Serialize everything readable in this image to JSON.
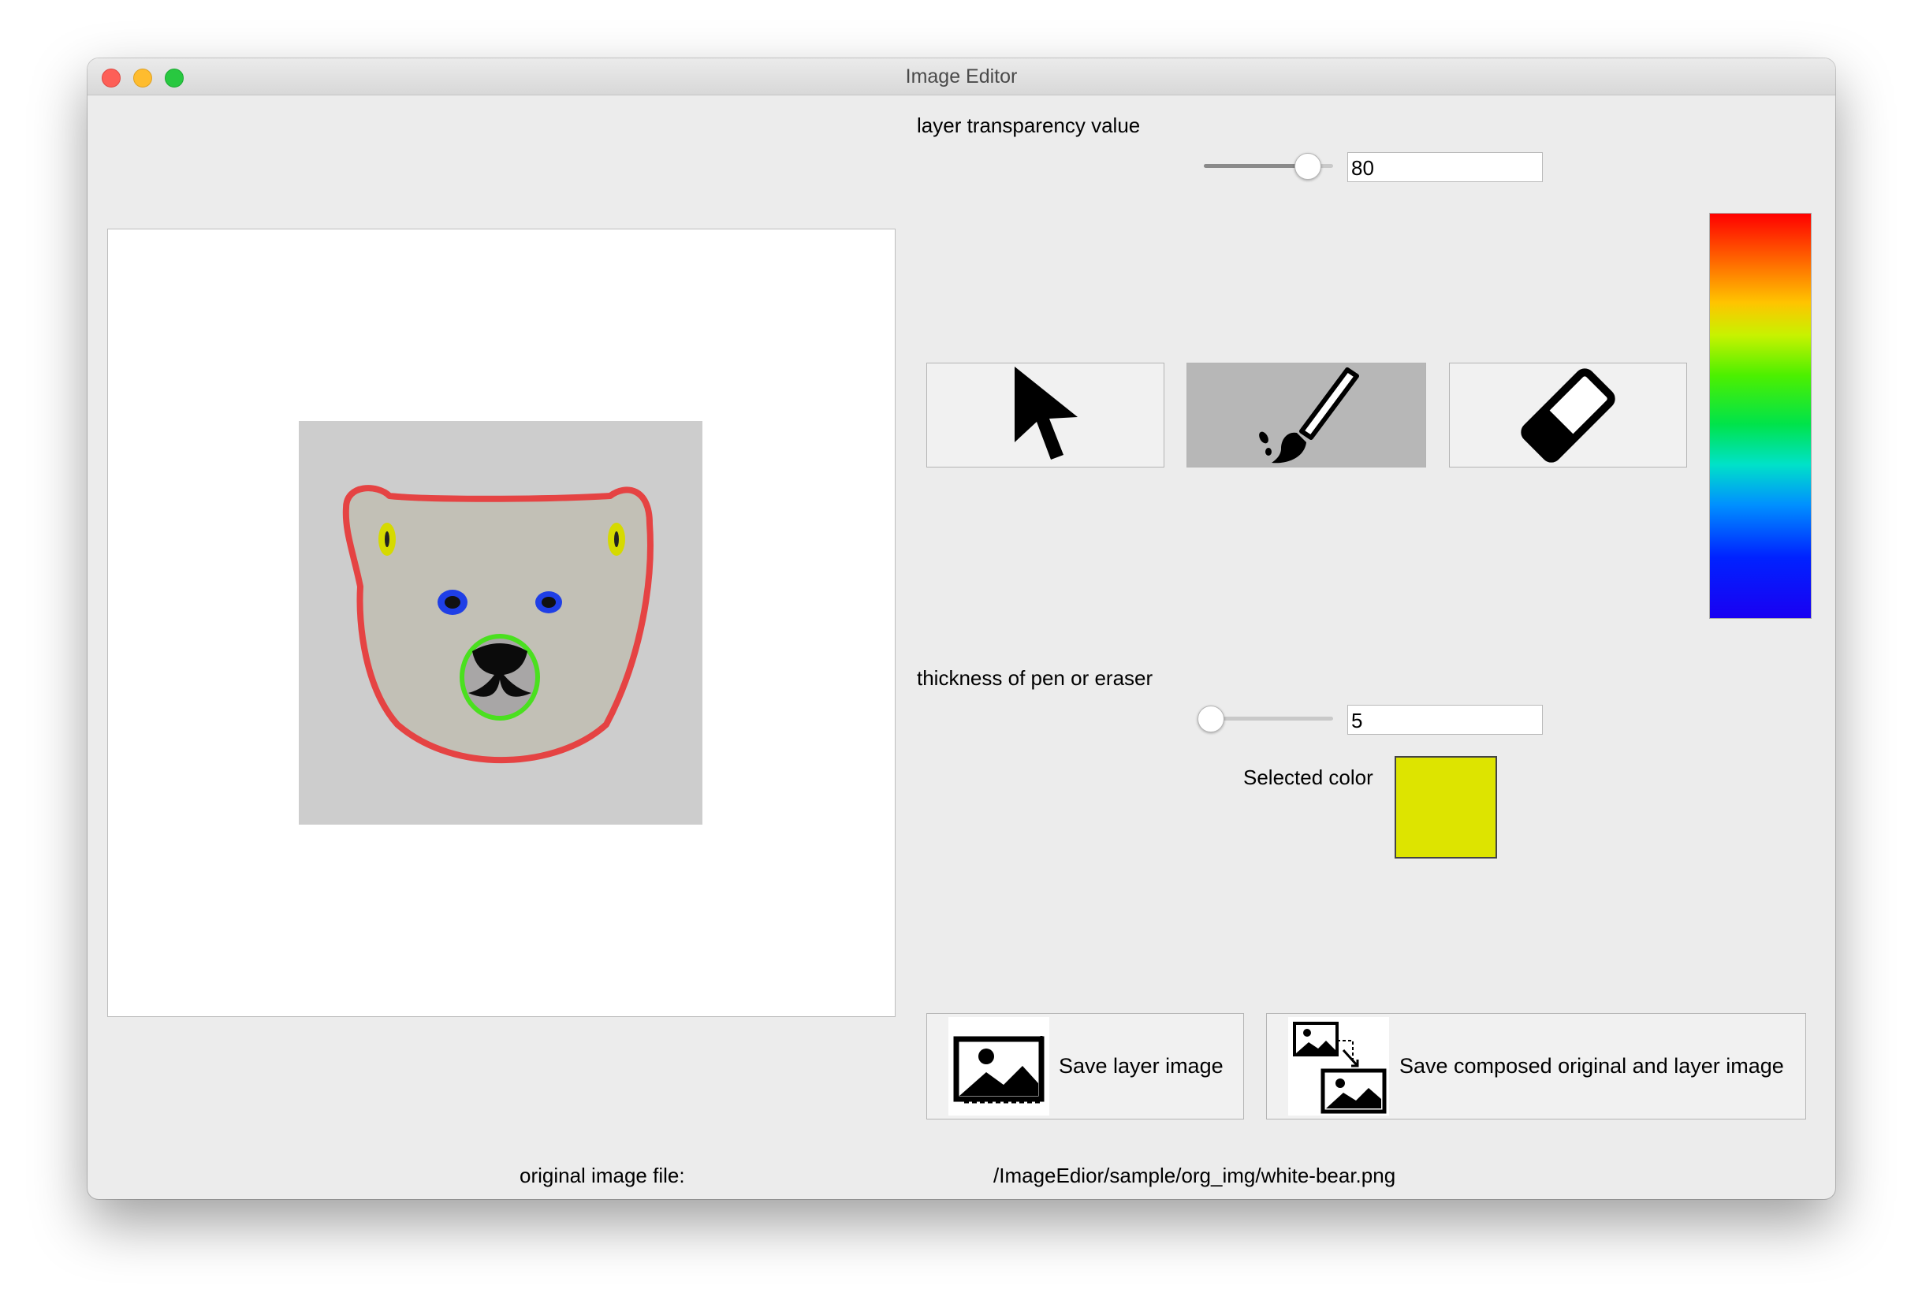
{
  "window": {
    "title": "Image Editor"
  },
  "transparency": {
    "label": "layer transparency value",
    "value": "80",
    "fraction": 0.8
  },
  "thickness": {
    "label": "thickness of pen or eraser",
    "value": "5",
    "fraction": 0.05
  },
  "tools": [
    {
      "name": "select",
      "icon": "cursor-arrow-icon",
      "active": false
    },
    {
      "name": "brush",
      "icon": "paintbrush-icon",
      "active": true
    },
    {
      "name": "eraser",
      "icon": "eraser-icon",
      "active": false
    }
  ],
  "color_picker": {
    "colors": [
      "#ff0000",
      "#ffc400",
      "#4cf000",
      "#00e2c8",
      "#0022ff"
    ]
  },
  "selected_color": {
    "label": "Selected color",
    "value": "#dde400"
  },
  "buttons": {
    "save_layer": "Save layer image",
    "save_composed": "Save composed original and layer image"
  },
  "footer": {
    "label": "original image file:",
    "path": "/ImageEdior/sample/org_img/white-bear.png"
  }
}
